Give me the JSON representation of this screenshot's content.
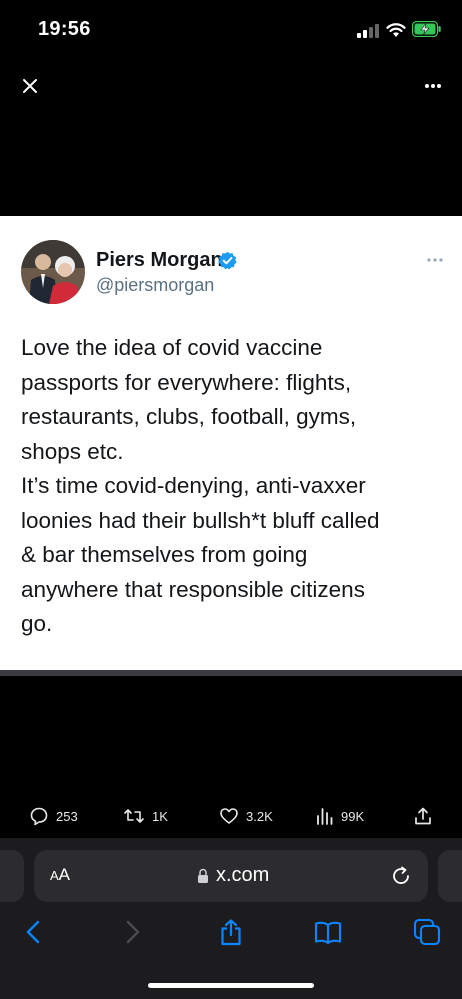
{
  "status_bar": {
    "time": "19:56"
  },
  "tweet": {
    "author_name": "Piers Morgan",
    "author_handle": "@piersmorgan",
    "lines": [
      "Love the idea of covid vaccine",
      "passports for everywhere: flights,",
      "restaurants, clubs, football, gyms,",
      "shops etc.",
      "It’s time covid-denying, anti-vaxxer",
      "loonies had their bullsh*t bluff called",
      "& bar themselves from going",
      "anywhere that responsible citizens",
      "go."
    ]
  },
  "engagement": {
    "replies": "253",
    "reposts": "1K",
    "likes": "3.2K",
    "views": "99K"
  },
  "browser": {
    "text_size_big": "A",
    "text_size_small": "A",
    "url": "x.com"
  },
  "colors": {
    "accent_blue": "#1d9bf0",
    "safari_blue": "#0a84ff",
    "battery_green": "#34c759"
  }
}
